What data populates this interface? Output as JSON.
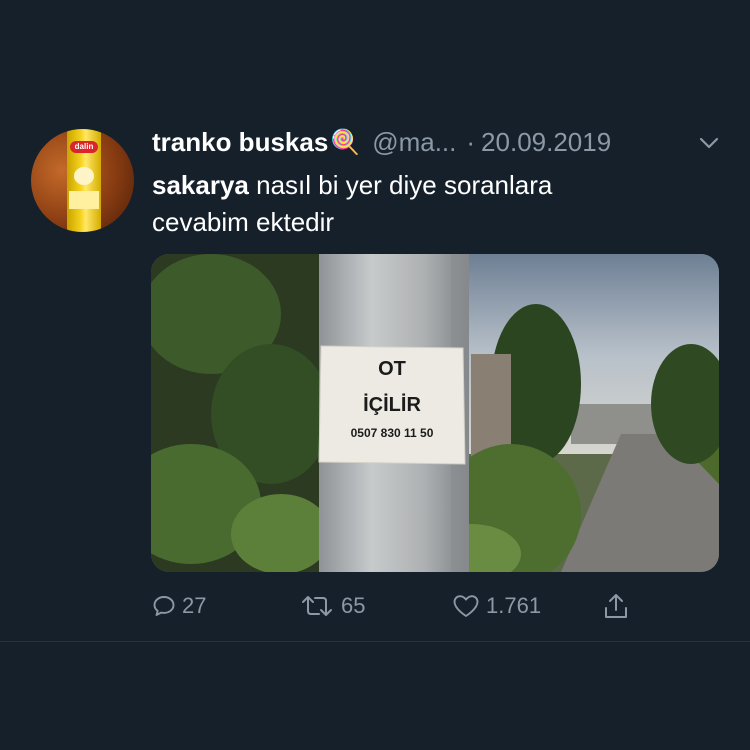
{
  "tweet": {
    "author_name": "tranko buskas",
    "author_emoji": "🍭",
    "handle": "@ma...",
    "separator": "·",
    "date": "20.09.2019",
    "text_mention": "sakarya",
    "text_line1_rest": " nasıl bi yer diye soranlara",
    "text_line2": "cevabim ektedir",
    "avatar_label": "dalin"
  },
  "media": {
    "sign_line1": "OT",
    "sign_line2": "İÇİLİR",
    "sign_phone": "0507 830 11 50"
  },
  "actions": {
    "replies": "27",
    "retweets": "65",
    "likes": "1.761"
  },
  "colors": {
    "background": "#15202b",
    "secondary_text": "#8b98a5",
    "primary_text": "#ffffff"
  }
}
